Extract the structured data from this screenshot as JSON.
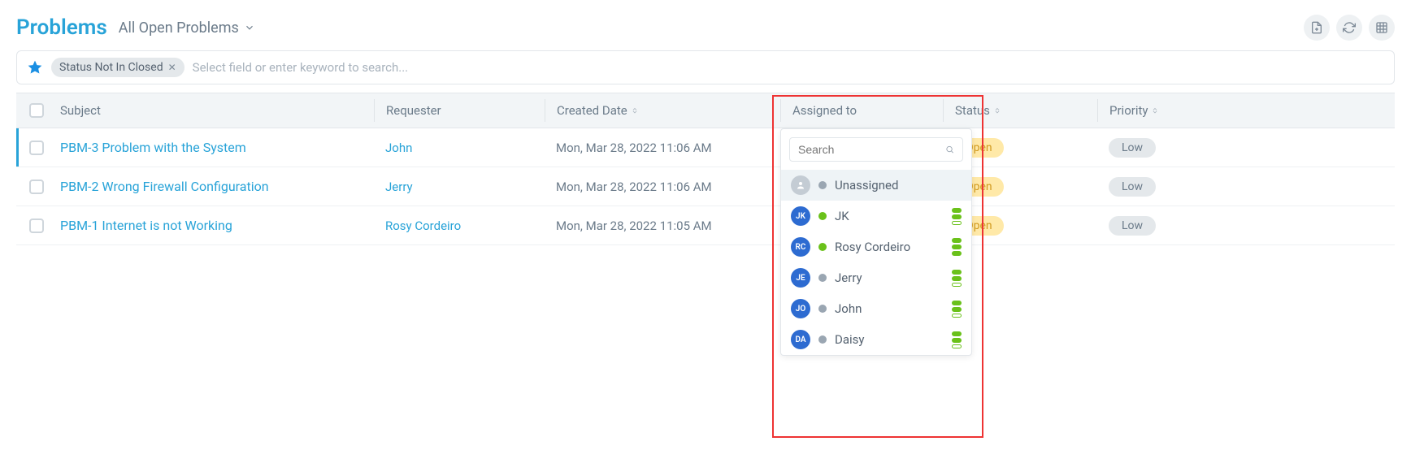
{
  "header": {
    "title": "Problems",
    "filter_label": "All Open Problems"
  },
  "search": {
    "chip_text": "Status Not In Closed",
    "placeholder": "Select field or enter keyword to search..."
  },
  "columns": {
    "subject": "Subject",
    "requester": "Requester",
    "created": "Created Date",
    "assigned": "Assigned to",
    "status": "Status",
    "priority": "Priority"
  },
  "rows": [
    {
      "subject": "PBM-3 Problem with the System",
      "requester": "John",
      "created": "Mon, Mar 28, 2022 11:06 AM",
      "assigned": "Unassigned",
      "status": "Open",
      "priority": "Low"
    },
    {
      "subject": "PBM-2 Wrong Firewall Configuration",
      "requester": "Jerry",
      "created": "Mon, Mar 28, 2022 11:06 AM",
      "assigned": "",
      "status": "Open",
      "priority": "Low"
    },
    {
      "subject": "PBM-1 Internet is not Working",
      "requester": "Rosy Cordeiro",
      "created": "Mon, Mar 28, 2022 11:05 AM",
      "assigned": "",
      "status": "Open",
      "priority": "Low"
    }
  ],
  "dropdown": {
    "search_placeholder": "Search",
    "items": [
      {
        "initials": "",
        "name": "Unassigned",
        "avatar": "gray",
        "dot": "gray",
        "cap": [
          false,
          false,
          false
        ]
      },
      {
        "initials": "JK",
        "name": "JK",
        "avatar": "blue",
        "dot": "green",
        "cap": [
          true,
          true,
          false
        ]
      },
      {
        "initials": "RC",
        "name": "Rosy Cordeiro",
        "avatar": "blue",
        "dot": "green",
        "cap": [
          true,
          true,
          true
        ]
      },
      {
        "initials": "JE",
        "name": "Jerry",
        "avatar": "blue",
        "dot": "gray",
        "cap": [
          true,
          true,
          false
        ]
      },
      {
        "initials": "JO",
        "name": "John",
        "avatar": "blue",
        "dot": "gray",
        "cap": [
          true,
          true,
          false
        ]
      },
      {
        "initials": "DA",
        "name": "Daisy",
        "avatar": "blue",
        "dot": "gray",
        "cap": [
          true,
          true,
          false
        ]
      }
    ]
  }
}
